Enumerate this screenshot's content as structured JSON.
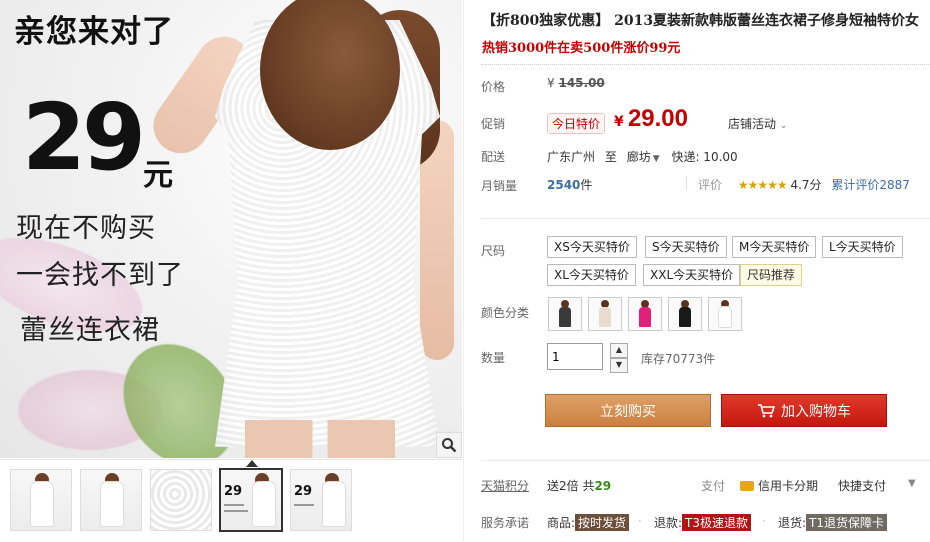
{
  "product": {
    "title": "【折800独家优惠】 2013夏装新款韩版蕾丝连衣裙子修身短袖特价女",
    "subtitle": "热销3000件在卖500件涨价99元"
  },
  "main_image": {
    "headline": "亲您来对了",
    "price_big": "29",
    "price_unit": "元",
    "line1": "现在不购买",
    "line2": "一会找不到了",
    "line3": "蕾丝连衣裙"
  },
  "thumbnails": [
    {
      "label": ""
    },
    {
      "label": ""
    },
    {
      "label": ""
    },
    {
      "label": "29",
      "active": true
    },
    {
      "label": "29"
    }
  ],
  "price": {
    "label": "价格",
    "currency": "¥",
    "original": "145.00"
  },
  "promo": {
    "label": "促销",
    "tag": "今日特价",
    "currency": "¥",
    "value": "29.00",
    "shop_activity": "店铺活动"
  },
  "shipping": {
    "label": "配送",
    "from": "广东广州",
    "to_word": "至",
    "dest": "廊坊",
    "express": "快递: 10.00"
  },
  "sales": {
    "label": "月销量",
    "count": "2540",
    "unit": "件",
    "review_label": "评价",
    "stars": "★★★★★",
    "score": "4.7分",
    "total_reviews": "累计评价2887"
  },
  "size": {
    "label": "尺码",
    "options": [
      "XS今天买特价",
      "S今天买特价",
      "M今天买特价",
      "L今天买特价",
      "XL今天买特价",
      "XXL今天买特价"
    ],
    "recommend": "尺码推荐"
  },
  "color": {
    "label": "颜色分类",
    "swatches": [
      "#3a3a3a",
      "#e9dccf",
      "#e0207a",
      "#1a1a1a",
      "#ffffff"
    ]
  },
  "quantity": {
    "label": "数量",
    "value": "1",
    "stock": "库存70773件"
  },
  "actions": {
    "buy": "立刻购买",
    "cart": "加入购物车"
  },
  "points": {
    "label": "天猫积分",
    "prefix": "送2倍 共",
    "value": "29"
  },
  "payment": {
    "label": "支付",
    "credit": "信用卡分期",
    "quick": "快捷支付"
  },
  "service": {
    "label": "服务承诺",
    "goods": "商品:",
    "goods_tag": "按时发货",
    "refund": "退款:",
    "refund_tag": "T3极速退款",
    "return": "退货:",
    "return_tag": "T1退货保障卡"
  },
  "colors": {
    "brand_red": "#c40000",
    "buy_orange": "#c9803f",
    "cart_red": "#c4170f"
  }
}
